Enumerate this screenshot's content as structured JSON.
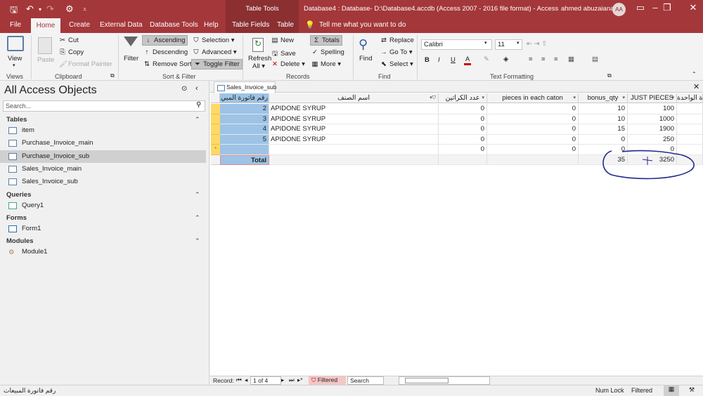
{
  "titlebar": {
    "title": "Database4 : Database- D:\\Database4.accdb (Access 2007 - 2016 file format)  -  Access",
    "tools_label": "Table Tools",
    "user": "ahmed abuzaiana",
    "avatar": "AA"
  },
  "tabs": [
    "File",
    "Home",
    "Create",
    "External Data",
    "Database Tools",
    "Help",
    "Table Fields",
    "Table"
  ],
  "tell_me": "Tell me what you want to do",
  "ribbon": {
    "views": {
      "group": "Views",
      "view": "View"
    },
    "clipboard": {
      "group": "Clipboard",
      "paste": "Paste",
      "cut": "Cut",
      "copy": "Copy",
      "format_painter": "Format Painter"
    },
    "sort_filter": {
      "group": "Sort & Filter",
      "filter": "Filter",
      "ascending": "Ascending",
      "descending": "Descending",
      "remove_sort": "Remove Sort",
      "selection": "Selection",
      "advanced": "Advanced",
      "toggle_filter": "Toggle Filter"
    },
    "records": {
      "group": "Records",
      "refresh": "Refresh",
      "all": "All",
      "new": "New",
      "save": "Save",
      "delete": "Delete",
      "totals": "Totals",
      "spelling": "Spelling",
      "more": "More"
    },
    "find": {
      "group": "Find",
      "find": "Find",
      "replace": "Replace",
      "goto": "Go To",
      "select": "Select"
    },
    "text_formatting": {
      "group": "Text Formatting",
      "font": "Calibri",
      "size": "11",
      "bold": "B",
      "italic": "I",
      "underline": "U"
    }
  },
  "nav": {
    "title": "All Access Objects",
    "search_placeholder": "Search...",
    "sections": {
      "tables": "Tables",
      "queries": "Queries",
      "forms": "Forms",
      "modules": "Modules"
    },
    "tables": [
      "item",
      "Purchase_Invoice_main",
      "Purchase_Invoice_sub",
      "Sales_Invoice_main",
      "Sales_Invoice_sub"
    ],
    "queries": [
      "Query1"
    ],
    "forms": [
      "Form1"
    ],
    "modules": [
      "Module1"
    ]
  },
  "document": {
    "tab": "Sales_Invoice_sub",
    "columns": [
      "رقم فاتورة المبي",
      "اسم الصنف",
      "عدد الكراتين",
      "pieces in each caton",
      "bonus_qty",
      "JUST PIECES",
      "ة الواحدة"
    ],
    "rows": [
      [
        "2",
        "APIDONE SYRUP",
        "0",
        "0",
        "10",
        "100"
      ],
      [
        "3",
        "APIDONE SYRUP",
        "0",
        "0",
        "10",
        "1000"
      ],
      [
        "4",
        "APIDONE SYRUP",
        "0",
        "0",
        "15",
        "1900"
      ],
      [
        "5",
        "APIDONE SYRUP",
        "0",
        "0",
        "0",
        "250"
      ],
      [
        "",
        "",
        "0",
        "0",
        "0",
        "0"
      ]
    ],
    "new_row_marker": "*",
    "total_label": "Total",
    "totals": {
      "bonus_qty": "35",
      "just_pieces": "3250"
    }
  },
  "record_nav": {
    "label": "Record:",
    "position": "1 of 4",
    "filter_state": "Filtered",
    "search": "Search"
  },
  "statusbar": {
    "left": "رقم فاتورة المبيعات",
    "num_lock": "Num Lock",
    "filtered": "Filtered"
  },
  "colors": {
    "brand": "#a4373a",
    "selected_column": "#9dc3e6",
    "annotation": "#1f2a8c"
  }
}
